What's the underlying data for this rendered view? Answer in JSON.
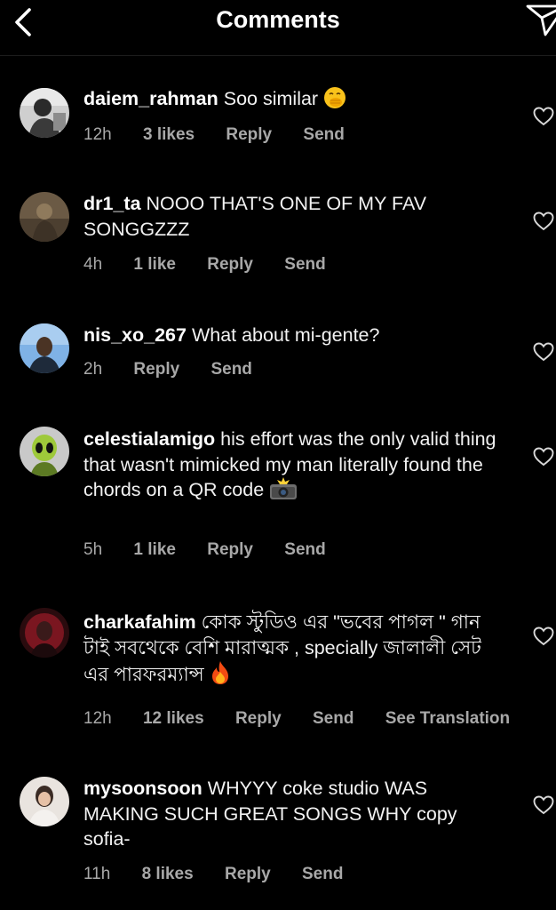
{
  "header": {
    "title": "Comments",
    "back_icon": "chevron-left-icon",
    "send_icon": "paper-plane-icon"
  },
  "comments": [
    {
      "username": "daiem_rahman",
      "text": "Soo similar",
      "emoji": "face-with-hand-over-mouth",
      "time": "12h",
      "likes": "3 likes",
      "reply": "Reply",
      "send": "Send"
    },
    {
      "username": "dr1_ta",
      "text": "NOOO THAT'S ONE OF MY FAV SONGGZZZ",
      "time": "4h",
      "likes": "1 like",
      "reply": "Reply",
      "send": "Send"
    },
    {
      "username": "nis_xo_267",
      "text": "What about mi-gente?",
      "time": "2h",
      "reply": "Reply",
      "send": "Send"
    },
    {
      "username": "celestialamigo",
      "text": "his effort was the only valid thing that wasn't mimicked my man literally found the chords on a QR code",
      "emoji": "camera-with-flash",
      "time": "5h",
      "likes": "1 like",
      "reply": "Reply",
      "send": "Send"
    },
    {
      "username": "charkafahim",
      "text": "কোক স্টুডিও এর \"ভবের পাগল \" গান টাই সবথেকে বেশি মারাত্মক , specially জালালী সেট  এর পারফরম্যান্স",
      "emoji": "fire",
      "time": "12h",
      "likes": "12 likes",
      "reply": "Reply",
      "send": "Send",
      "translate": "See Translation"
    },
    {
      "username": "mysoonsoon",
      "text": "WHYYY coke studio WAS MAKING SUCH GREAT SONGS WHY copy sofia-",
      "time": "11h",
      "likes": "8 likes",
      "reply": "Reply",
      "send": "Send"
    }
  ],
  "colors": {
    "background": "#000000",
    "text": "#f5f5f5",
    "meta": "#a8a8a8"
  }
}
